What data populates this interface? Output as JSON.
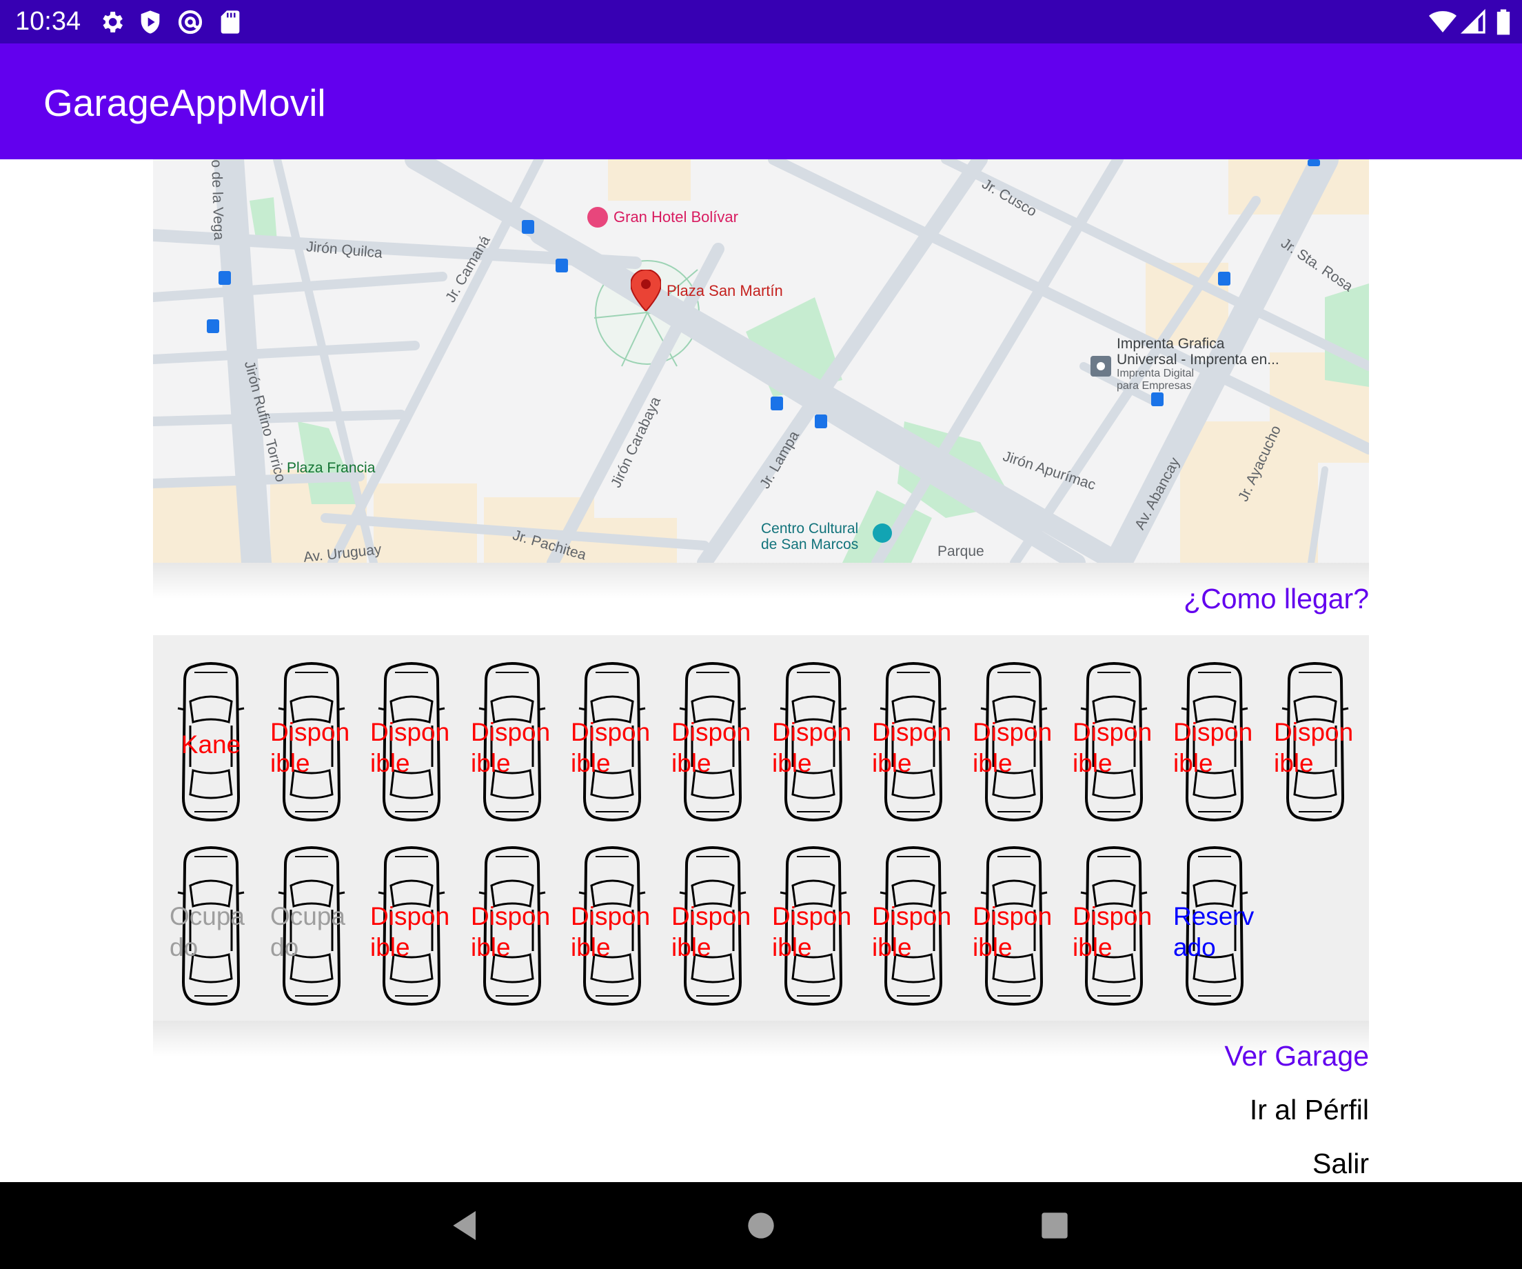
{
  "status_bar": {
    "time": "10:34",
    "left_icons": [
      "gear-icon",
      "shield-play-icon",
      "at-sign-icon",
      "sd-card-icon"
    ],
    "right_icons": [
      "wifi-icon",
      "cell-signal-icon",
      "battery-icon"
    ]
  },
  "app_bar": {
    "title": "GarageAppMovil"
  },
  "map": {
    "pins": [
      "map-pin-icon"
    ],
    "labels": {
      "hotel": "Gran Hotel Bolívar",
      "plaza_san_martin": "Plaza San Martín",
      "imprenta_line1": "Imprenta Grafica",
      "imprenta_line2": "Universal - Imprenta en...",
      "imprenta_sub1": "Imprenta Digital",
      "imprenta_sub2": "para Empresas",
      "centro_line1": "Centro Cultural",
      "centro_line2": "de San Marcos",
      "plaza_francia": "Plaza Francia",
      "parque": "Parque",
      "quilca": "Jirón Quilca",
      "rufino": "Jirón Rufino Torrico",
      "camana": "Jr. Camaná",
      "carabaya": "Jirón Carabaya",
      "lampa": "Jr. Lampa",
      "apurimac": "Jirón Apurímac",
      "abancay": "Av. Abancay",
      "ayacucho": "Jr. Ayacucho",
      "cusco": "Jr. Cusco",
      "sta_rosa": "Jr. Sta. Rosa",
      "uruguay": "Av. Uruguay",
      "pachitea": "Jr. Pachitea",
      "de_la_vega": "o de la Vega"
    }
  },
  "como_llegar": "¿Como llegar?",
  "garage": {
    "row1": [
      {
        "label": "Kane",
        "status": "kane"
      },
      {
        "label": "Disponible",
        "status": "disponible"
      },
      {
        "label": "Disponible",
        "status": "disponible"
      },
      {
        "label": "Disponible",
        "status": "disponible"
      },
      {
        "label": "Disponible",
        "status": "disponible"
      },
      {
        "label": "Disponible",
        "status": "disponible"
      },
      {
        "label": "Disponible",
        "status": "disponible"
      },
      {
        "label": "Disponible",
        "status": "disponible"
      },
      {
        "label": "Disponible",
        "status": "disponible"
      },
      {
        "label": "Disponible",
        "status": "disponible"
      },
      {
        "label": "Disponible",
        "status": "disponible"
      },
      {
        "label": "Disponible",
        "status": "disponible"
      }
    ],
    "row2": [
      {
        "label": "Ocupado",
        "status": "ocupado"
      },
      {
        "label": "Ocupado",
        "status": "ocupado"
      },
      {
        "label": "Disponible",
        "status": "disponible"
      },
      {
        "label": "Disponible",
        "status": "disponible"
      },
      {
        "label": "Disponible",
        "status": "disponible"
      },
      {
        "label": "Disponible",
        "status": "disponible"
      },
      {
        "label": "Disponible",
        "status": "disponible"
      },
      {
        "label": "Disponible",
        "status": "disponible"
      },
      {
        "label": "Disponible",
        "status": "disponible"
      },
      {
        "label": "Disponible",
        "status": "disponible"
      },
      {
        "label": "Reservado",
        "status": "reservado"
      }
    ],
    "colors": {
      "disponible": "#ff0000",
      "ocupado": "#9e9e9e",
      "reservado": "#0000ff"
    }
  },
  "links": {
    "ver_garage": "Ver Garage",
    "ir_perfil": "Ir al Pérfil",
    "salir": "Salir"
  },
  "nav_bar": {
    "icons": [
      "back-icon",
      "home-icon",
      "recents-icon"
    ]
  },
  "colors": {
    "status_bar": "#3700b3",
    "app_bar": "#6200ee",
    "accent_link": "#6200ee"
  }
}
